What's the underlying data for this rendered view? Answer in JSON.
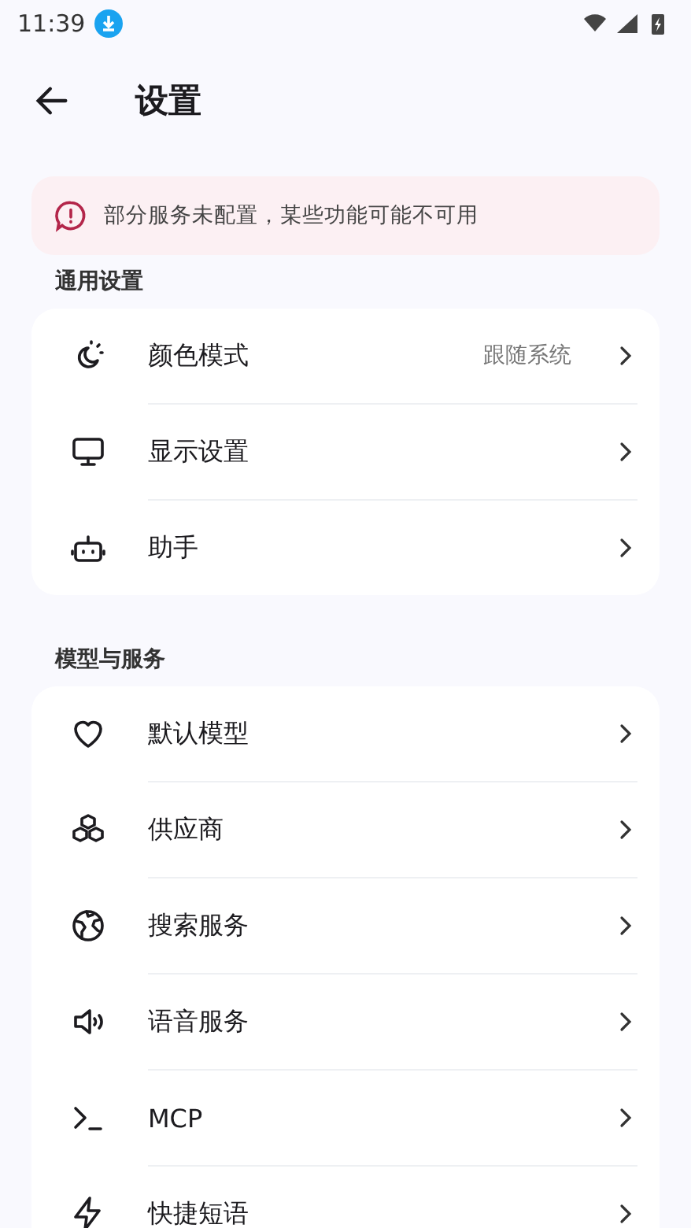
{
  "status_bar": {
    "time": "11:39"
  },
  "header": {
    "title": "设置"
  },
  "warning": {
    "text": "部分服务未配置，某些功能可能不可用"
  },
  "sections": [
    {
      "title": "通用设置",
      "items": [
        {
          "label": "颜色模式",
          "value": "跟随系统"
        },
        {
          "label": "显示设置"
        },
        {
          "label": "助手"
        }
      ]
    },
    {
      "title": "模型与服务",
      "items": [
        {
          "label": "默认模型"
        },
        {
          "label": "供应商"
        },
        {
          "label": "搜索服务"
        },
        {
          "label": "语音服务"
        },
        {
          "label": "MCP"
        },
        {
          "label": "快捷短语"
        }
      ]
    }
  ]
}
